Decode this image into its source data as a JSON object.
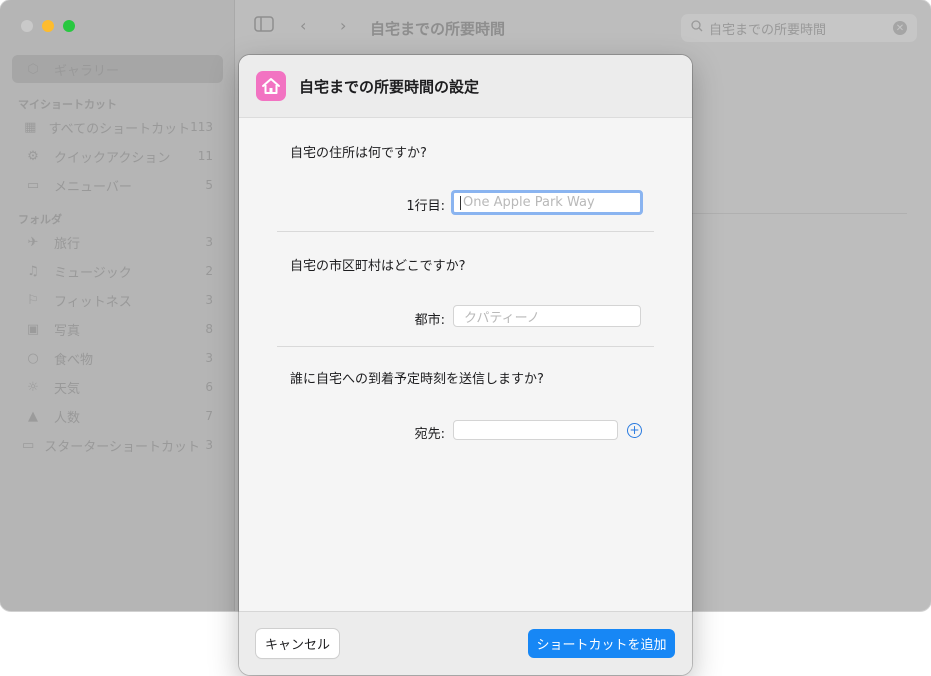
{
  "window": {
    "title": "自宅までの所要時間",
    "search_text": "自宅までの所要時間"
  },
  "sidebar": {
    "gallery_label": "ギャラリー",
    "my_shortcuts_header": "マイショートカット",
    "my_shortcuts": [
      {
        "label": "すべてのショートカット",
        "count": "113",
        "icon": "grid-icon"
      },
      {
        "label": "クイックアクション",
        "count": "11",
        "icon": "gear-icon"
      },
      {
        "label": "メニューバー",
        "count": "5",
        "icon": "menubar-icon"
      }
    ],
    "folders_header": "フォルダ",
    "folders": [
      {
        "label": "旅行",
        "count": "3",
        "icon": "airplane-icon"
      },
      {
        "label": "ミュージック",
        "count": "2",
        "icon": "music-note-icon"
      },
      {
        "label": "フィットネス",
        "count": "3",
        "icon": "running-figure-icon"
      },
      {
        "label": "写真",
        "count": "8",
        "icon": "camera-icon"
      },
      {
        "label": "食べ物",
        "count": "3",
        "icon": "circle-icon"
      },
      {
        "label": "天気",
        "count": "6",
        "icon": "sun-icon"
      },
      {
        "label": "人数",
        "count": "7",
        "icon": "person-icon"
      },
      {
        "label": "スターターショートカット",
        "count": "3",
        "icon": "folder-icon"
      }
    ]
  },
  "sheet": {
    "title": "自宅までの所要時間の設定",
    "questions": [
      {
        "question": "自宅の住所は何ですか?",
        "field_label": "1行目:",
        "placeholder": "One Apple Park Way"
      },
      {
        "question": "自宅の市区町村はどこですか?",
        "field_label": "都市:",
        "placeholder": "クパティーノ"
      },
      {
        "question": "誰に自宅への到着予定時刻を送信しますか?",
        "field_label": "宛先:",
        "placeholder": ""
      }
    ],
    "cancel_label": "キャンセル",
    "add_label": "ショートカットを追加"
  },
  "colors": {
    "accent": "#1787f5",
    "app_icon": "#f273c2",
    "traffic_min": "#febc2e",
    "traffic_max": "#28c840"
  }
}
